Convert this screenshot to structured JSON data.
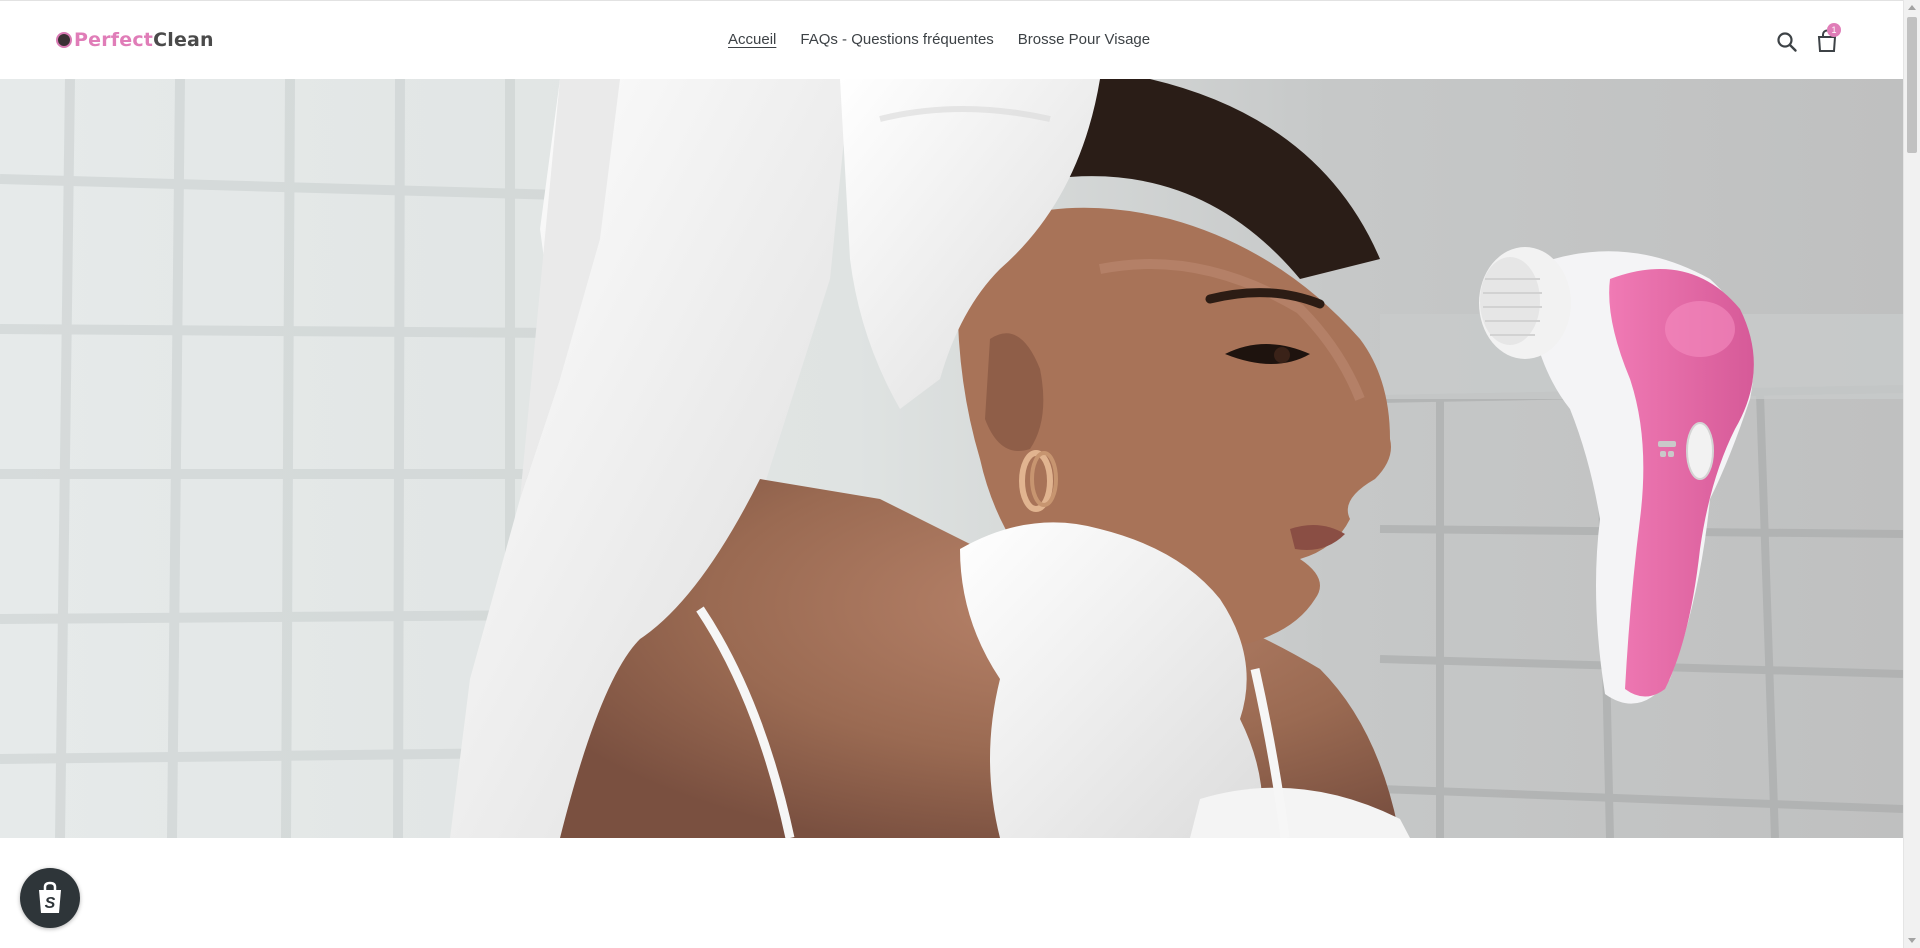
{
  "brand": {
    "logo_part_1": "Perfect",
    "logo_part_2": "Clean",
    "accent_color": "#e07db8"
  },
  "nav": {
    "items": [
      {
        "label": "Accueil",
        "active": true
      },
      {
        "label": "FAQs - Questions fréquentes",
        "active": false
      },
      {
        "label": "Brosse Pour Visage",
        "active": false
      }
    ]
  },
  "header_icons": {
    "search": "search-icon",
    "cart": "cart-icon",
    "cart_count": "1"
  },
  "hero": {
    "image_alt": "Woman with towel on head next to pink facial cleansing brush",
    "accessory_icon": "facial-brush-icon"
  },
  "shopify_badge": {
    "icon": "shopify-bag-icon"
  }
}
